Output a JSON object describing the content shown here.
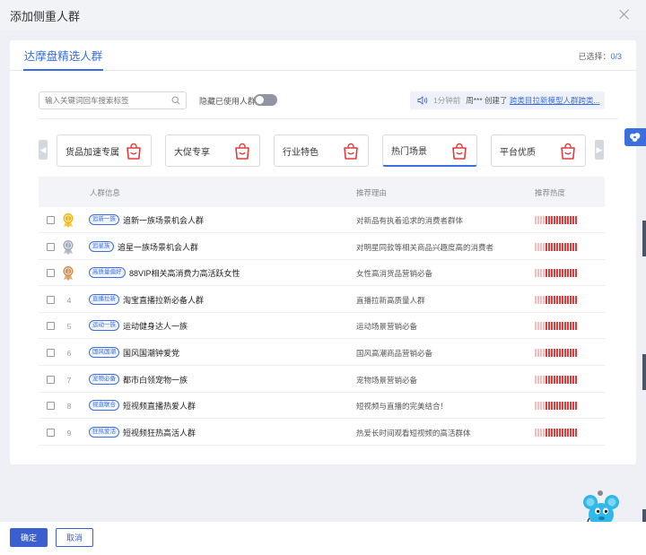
{
  "modal": {
    "title": "添加侧重人群"
  },
  "tabs": [
    {
      "label": "达摩盘精选人群"
    }
  ],
  "selection": {
    "label": "已选择：",
    "value": "0/3"
  },
  "search": {
    "placeholder": "输入关键词回车搜索标签"
  },
  "hide_used": {
    "label": "隐藏已使用人群",
    "on": false
  },
  "notice": {
    "time": "1分钟前",
    "user": "周***",
    "action": "创建了",
    "link": "跨类目拉新模型人群跨类..."
  },
  "categories": [
    {
      "label": "货品加速专属",
      "active": false
    },
    {
      "label": "大促专享",
      "active": false
    },
    {
      "label": "行业特色",
      "active": false
    },
    {
      "label": "热门场景",
      "active": true
    },
    {
      "label": "平台优质",
      "active": false
    }
  ],
  "table": {
    "headers": {
      "info": "人群信息",
      "reason": "推荐理由",
      "heat": "推荐热度"
    },
    "rows": [
      {
        "rank": "1",
        "tag": "追新一族",
        "name": "追新一族场景机会人群",
        "reason": "对新品有执着追求的消费者群体",
        "heat": 0.72
      },
      {
        "rank": "2",
        "tag": "追星族",
        "name": "追星一族场景机会人群",
        "reason": "对明星同款等相关商品兴趣度高的消费者",
        "heat": 0.72
      },
      {
        "rank": "3",
        "tag": "高质量偏好",
        "name": "88VIP相关高消费力高活跃女性",
        "reason": "女性高消货品营销必备",
        "heat": 0.72
      },
      {
        "rank": "4",
        "tag": "直播拉新",
        "name": "淘宝直播拉新必备人群",
        "reason": "直播拉新高质量人群",
        "heat": 0.72
      },
      {
        "rank": "5",
        "tag": "运动一族",
        "name": "运动健身达人一族",
        "reason": "运动场景营销必备",
        "heat": 0.72
      },
      {
        "rank": "6",
        "tag": "国风国潮",
        "name": "国风国潮钟爱党",
        "reason": "国风高潮商品营销必备",
        "heat": 0.72
      },
      {
        "rank": "7",
        "tag": "宠物必备",
        "name": "都市白领宠物一族",
        "reason": "宠物场景营销必备",
        "heat": 0.72
      },
      {
        "rank": "8",
        "tag": "视直联合",
        "name": "短视频直播热爱人群",
        "reason": "短视频与直播的完美结合！",
        "heat": 0.72
      },
      {
        "rank": "9",
        "tag": "狂热爱活",
        "name": "短视频狂热高活人群",
        "reason": "热爱长时间观看短视频的高活群体",
        "heat": 0.72
      }
    ]
  },
  "footer": {
    "confirm": "确定",
    "cancel": "取消"
  },
  "colors": {
    "accent": "#3b6fe0",
    "heat": "#e23b3b",
    "heat_faint": "#f4bcbc"
  }
}
